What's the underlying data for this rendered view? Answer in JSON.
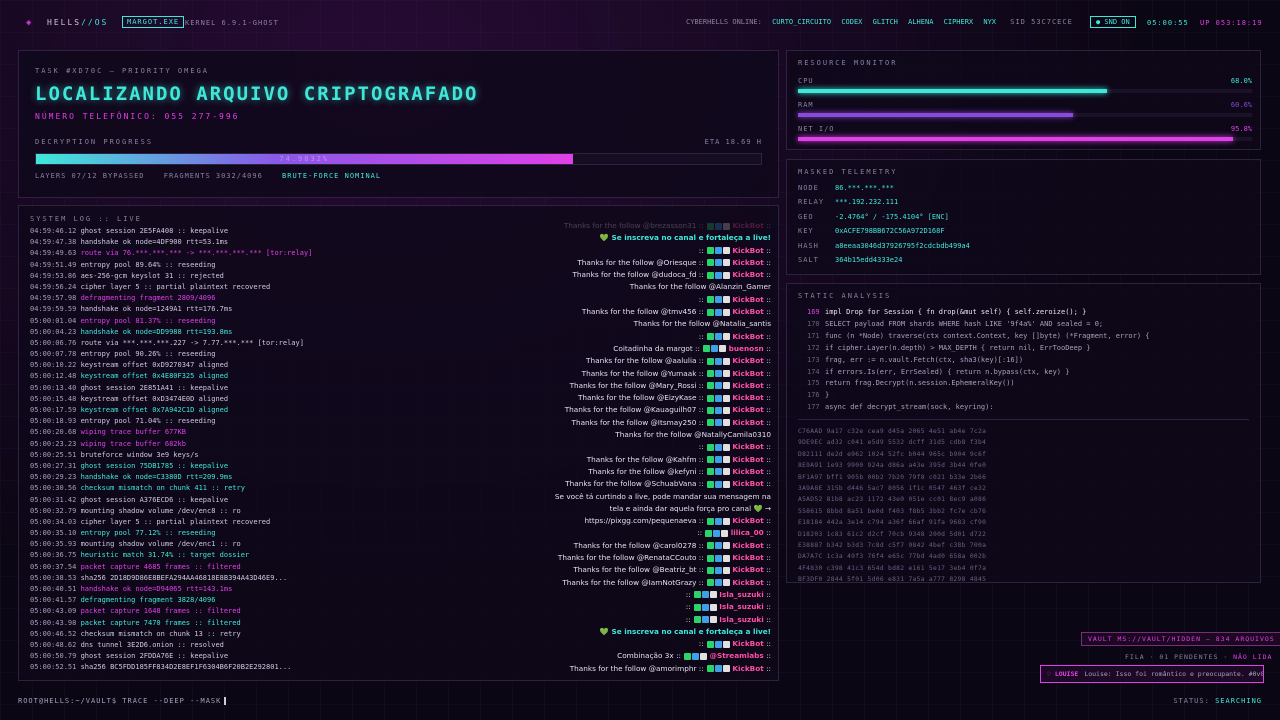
{
  "topbar": {
    "logo": "◈",
    "brand_a": "HELLS",
    "brand_b": "//OS",
    "process": "MARGOT.EXE",
    "kernel": "KERNEL 6.9.1-GHOST",
    "online_label": "CYBERHELLS ONLINE:",
    "online_users": [
      "CURTO_CIRCUITO",
      "CODEX",
      "GLITCH",
      "ALHENA",
      "CIPHERX",
      "NYX"
    ],
    "sid": "SID 53C7CECE",
    "snd": "● SND ON",
    "clock": "05:00:55",
    "uptime": "UP 053:18:19"
  },
  "task": {
    "id": "TASK #XD70C — PRIORITY OMEGA",
    "title": "LOCALIZANDO ARQUIVO CRIPTOGRAFADO",
    "phone": "NÚMERO TELEFÔNICO: 055 277-996",
    "progress_label": "DECRYPTION PROGRESS",
    "eta": "ETA 18.69 H",
    "progress_percent": 74,
    "progress_text": "74.9832%",
    "layers": "LAYERS 07/12 BYPASSED",
    "fragments": "FRAGMENTS 3032/4096",
    "status": "BRUTE-FORCE NOMINAL"
  },
  "syslog": {
    "header": "SYSTEM LOG :: LIVE",
    "lines": [
      {
        "ts": "04:59:46.12",
        "msg": "ghost session 2E5FA408 :: keepalive",
        "tone": ""
      },
      {
        "ts": "04:59:47.38",
        "msg": "handshake ok node=4DF900 rtt=53.1ms",
        "tone": ""
      },
      {
        "ts": "04:59:49.63",
        "msg": "route via 76.***.***.*** -> ***.***.***.*** [tor:relay]",
        "tone": "mag"
      },
      {
        "ts": "04:59:51.49",
        "msg": "entropy pool 89.64% :: reseeding",
        "tone": ""
      },
      {
        "ts": "04:59:53.86",
        "msg": "aes-256-gcm keyslot 31 :: rejected",
        "tone": ""
      },
      {
        "ts": "04:59:56.24",
        "msg": "cipher layer 5 :: partial plaintext recovered",
        "tone": ""
      },
      {
        "ts": "04:59:57.98",
        "msg": "defragmenting fragment 2809/4096",
        "tone": "mag"
      },
      {
        "ts": "04:59:59.59",
        "msg": "handshake ok node=1249A1 rtt=176.7ms",
        "tone": ""
      },
      {
        "ts": "05:00:01.04",
        "msg": "entropy pool 81.37% :: reseeding",
        "tone": "mag"
      },
      {
        "ts": "05:00:04.23",
        "msg": "handshake ok node=DD9988 rtt=193.8ms",
        "tone": "cyan"
      },
      {
        "ts": "05:00:06.76",
        "msg": "route via ***.***.***.227 -> 7.77.***.*** [tor:relay]",
        "tone": ""
      },
      {
        "ts": "05:00:07.78",
        "msg": "entropy pool 90.26% :: reseeding",
        "tone": ""
      },
      {
        "ts": "05:00:10.22",
        "msg": "keystream offset 0xD9270347 aligned",
        "tone": ""
      },
      {
        "ts": "05:00:12.48",
        "msg": "keystream offset 0x4E80F325 aligned",
        "tone": "cyan"
      },
      {
        "ts": "05:00:13.40",
        "msg": "ghost session 2E851A41 :: keepalive",
        "tone": ""
      },
      {
        "ts": "05:00:15.48",
        "msg": "keystream offset 0xD3474E0D aligned",
        "tone": ""
      },
      {
        "ts": "05:00:17.59",
        "msg": "keystream offset 0x7A942C1D aligned",
        "tone": "cyan"
      },
      {
        "ts": "05:00:18.93",
        "msg": "entropy pool 71.04% :: reseeding",
        "tone": ""
      },
      {
        "ts": "05:00:20.68",
        "msg": "wiping trace buffer 677KB",
        "tone": "mag"
      },
      {
        "ts": "05:00:23.23",
        "msg": "wiping trace buffer 682kb",
        "tone": "mag"
      },
      {
        "ts": "05:00:25.51",
        "msg": "bruteforce window 3e9 keys/s",
        "tone": ""
      },
      {
        "ts": "05:00:27.31",
        "msg": "ghost session 75DB1785 :: keepalive",
        "tone": "cyan"
      },
      {
        "ts": "05:00:29.23",
        "msg": "handshake ok node=C3380D rtt=209.9ms",
        "tone": "cyan"
      },
      {
        "ts": "05:00:30.56",
        "msg": "checksum mismatch on chunk 411 :: retry",
        "tone": "cyan"
      },
      {
        "ts": "05:00:31.42",
        "msg": "ghost session A376ECD6 :: keepalive",
        "tone": ""
      },
      {
        "ts": "05:00:32.79",
        "msg": "mounting shadow volume /dev/enc8 :: ro",
        "tone": ""
      },
      {
        "ts": "05:00:34.03",
        "msg": "cipher layer 5 :: partial plaintext recovered",
        "tone": ""
      },
      {
        "ts": "05:00:35.10",
        "msg": "entropy pool 77.12% :: reseeding",
        "tone": "cyan"
      },
      {
        "ts": "05:00:35.93",
        "msg": "mounting shadow volume /dev/enc1 :: ro",
        "tone": ""
      },
      {
        "ts": "05:00:36.75",
        "msg": "heuristic match 31.74% :: target dossier",
        "tone": "cyan"
      },
      {
        "ts": "05:00:37.54",
        "msg": "packet capture 4685 frames :: filtered",
        "tone": "mag"
      },
      {
        "ts": "05:00:38.53",
        "msg": "sha256 2D18D9D86E8BEFA294AA46818E8B394A43D46E9...",
        "tone": ""
      },
      {
        "ts": "05:00:40.51",
        "msg": "handshake ok node=D94065 rtt=143.1ms",
        "tone": "mag"
      },
      {
        "ts": "05:00:41.57",
        "msg": "defragmenting fragment 3828/4096",
        "tone": "cyan"
      },
      {
        "ts": "05:00:43.09",
        "msg": "packet capture 1648 frames :: filtered",
        "tone": "mag"
      },
      {
        "ts": "05:00:43.98",
        "msg": "packet capture 7470 frames :: filtered",
        "tone": "cyan"
      },
      {
        "ts": "05:00:46.52",
        "msg": "checksum mismatch on chunk 13 :: retry",
        "tone": ""
      },
      {
        "ts": "05:00:48.62",
        "msg": "dns tunnel 3E2D6.onion :: resolved",
        "tone": ""
      },
      {
        "ts": "05:00:50.79",
        "msg": "ghost session 2FDDA76E :: keepalive",
        "tone": ""
      },
      {
        "ts": "05:00:52.51",
        "msg": "sha256 BC5FDD185FF834D2E8EF1F6304B6F20B2E292801...",
        "tone": ""
      }
    ]
  },
  "chat": [
    {
      "text": "Thanks for the follow @brezasson31",
      "bot": "KickBot",
      "fade": true
    },
    {
      "text": "💚 Se inscreva no canal e fortaleça a live!",
      "bot": "",
      "hl": true
    },
    {
      "text": "",
      "bot": "KickBot"
    },
    {
      "text": "Thanks for the follow @Oriesque",
      "bot": "KickBot"
    },
    {
      "text": "Thanks for the follow @dudoca_fd",
      "bot": "KickBot"
    },
    {
      "text": "Thanks for the follow @Alanzin_Gamer",
      "bot": ""
    },
    {
      "text": "",
      "bot": "KickBot"
    },
    {
      "text": "Thanks for the follow @tmv456",
      "bot": "KickBot"
    },
    {
      "text": "Thanks for the follow @Natalia_santis",
      "bot": ""
    },
    {
      "text": "",
      "bot": "KickBot"
    },
    {
      "text": "Coitadinha da margot",
      "bot": "buenosn"
    },
    {
      "text": "Thanks for the follow @aalulia",
      "bot": "KickBot"
    },
    {
      "text": "Thanks for the follow @Yumaak",
      "bot": "KickBot"
    },
    {
      "text": "Thanks for the follow @Mary_Rossi",
      "bot": "KickBot"
    },
    {
      "text": "Thanks for the follow @EizyKase",
      "bot": "KickBot"
    },
    {
      "text": "Thanks for the follow @Kauaguilh07",
      "bot": "KickBot"
    },
    {
      "text": "Thanks for the follow @Itsmay250",
      "bot": "KickBot"
    },
    {
      "text": "Thanks for the follow @NatallyCamila0310",
      "bot": ""
    },
    {
      "text": "",
      "bot": "KickBot"
    },
    {
      "text": "Thanks for the follow @Kahfm",
      "bot": "KickBot"
    },
    {
      "text": "Thanks for the follow @kefyni",
      "bot": "KickBot"
    },
    {
      "text": "Thanks for the follow @SchuabVana",
      "bot": "KickBot"
    },
    {
      "text": "Se você tá curtindo a live, pode mandar sua mensagem na",
      "bot": ""
    },
    {
      "text": "tela e ainda dar aquela força pro canal 💚 →",
      "bot": ""
    },
    {
      "text": "https://pixgg.com/pequenaeva",
      "bot": "KickBot"
    },
    {
      "text": "",
      "bot": "lilica_00"
    },
    {
      "text": "Thanks for the follow @carol0278",
      "bot": "KickBot"
    },
    {
      "text": "Thanks for the follow @RenataCCouto",
      "bot": "KickBot"
    },
    {
      "text": "Thanks for the follow @Beatriz_bt",
      "bot": "KickBot"
    },
    {
      "text": "Thanks for the follow @IamNotGrazy",
      "bot": "KickBot"
    },
    {
      "text": "",
      "bot": "Isla_suzuki"
    },
    {
      "text": "",
      "bot": "Isla_suzuki"
    },
    {
      "text": "",
      "bot": "Isla_suzuki"
    },
    {
      "text": "💚 Se inscreva no canal e fortaleça a live!",
      "bot": "",
      "hl": true
    },
    {
      "text": "",
      "bot": "KickBot"
    },
    {
      "text": "Combinação 3x",
      "bot": "@Streamlabs"
    },
    {
      "text": "Thanks for the follow @amorimphr",
      "bot": "KickBot"
    }
  ],
  "resources": {
    "header": "RESOURCE MONITOR",
    "items": [
      {
        "label": "CPU",
        "value": "68.0%",
        "fraction": 0.68,
        "color": "#3ee8d8"
      },
      {
        "label": "RAM",
        "value": "60.6%",
        "fraction": 0.606,
        "color": "#8a4ad8"
      },
      {
        "label": "NET I/O",
        "value": "95.8%",
        "fraction": 0.958,
        "color": "#e040e8"
      }
    ]
  },
  "telemetry": {
    "header": "MASKED TELEMETRY",
    "rows": [
      {
        "k": "NODE",
        "v": "86.***.***.***"
      },
      {
        "k": "RELAY",
        "v": "***.192.232.111"
      },
      {
        "k": "GEO",
        "v": "-2.4764° / -175.4104° [ENC]"
      },
      {
        "k": "KEY",
        "v": "0xACFE798BB672C56A972D168F"
      },
      {
        "k": "HASH",
        "v": "a8eeaa3046d37926795f2cdcbdb499a4"
      },
      {
        "k": "SALT",
        "v": "364b15edd4333e24"
      }
    ]
  },
  "static": {
    "header": "STATIC ANALYSIS",
    "code": [
      {
        "ln": "169",
        "t": "impl Drop for Session { fn drop(&mut self) { self.zeroize(); }",
        "active": true
      },
      {
        "ln": "170",
        "t": "SELECT payload FROM shards WHERE hash LIKE '9f4a%' AND sealed = 0;"
      },
      {
        "ln": "171",
        "t": "func (n *Node) traverse(ctx context.Context, key []byte) (*Fragment, error) {"
      },
      {
        "ln": "172",
        "t": "if cipher.Layer(n.depth) > MAX_DEPTH { return nil, ErrTooDeep }"
      },
      {
        "ln": "173",
        "t": "frag, err := n.vault.Fetch(ctx, sha3(key)[:16])"
      },
      {
        "ln": "174",
        "t": "if errors.Is(err, ErrSealed) { return n.bypass(ctx, key) }"
      },
      {
        "ln": "175",
        "t": "return frag.Decrypt(n.session.EphemeralKey())"
      },
      {
        "ln": "176",
        "t": "}"
      },
      {
        "ln": "177",
        "t": "async def decrypt_stream(sock, keyring):"
      }
    ],
    "hex": [
      "C76AAD 9a17 c32e cea9 d45a 2065 4e51 ab4e 7c2a",
      "9DE9EC ad32 c041 e5d9 5532 dcff 31d5 cdb8 f3b4",
      "D82111 de2d e962 1024 52fc b044 965c b904 9c6f",
      "8E9A91 1e93 9900 924a d86a a43e 395d 3b44 0fe0",
      "BF1A97 bff1 905b 00b2 7b20 79f8 c021 b33e 2b66",
      "3A9A8E 315b d446 5ac7 8056 1f1c 0547 463f ce32",
      "A5AD52 81b8 ac23 1172 43e0 051e cc01 8ec9 a086",
      "558615 8bbd 8a51 be0d f403 f8b5 3bb2 fc7e cb76",
      "E18184 442a 3e14 c794 a36f 66af 91fa 9683 cf90",
      "D18203 1c83 61c2 d2cf 70cb 9348 200d 5d01 d722",
      "E38887 b342 b3d3 7c8d c5f7 9842 4bef c38b 700a",
      "DA7A7C 1c3a 49f3 76f4 e65c 77bd 4ad0 658a 002b",
      "4F4830 c398 41c3 654d bd82 e161 5e17 3eb4 0f7a",
      "BF3DF0 2844 5f01 5d06 e831 7a5a a777 8298 4845"
    ]
  },
  "vault": "VAULT MS://VAULT/HIDDEN — 834 ARQUIVOS",
  "queue": {
    "label": "FILA · 01 PENDENTES ·",
    "state": "NÃO LIDA"
  },
  "notif": {
    "user": "♡ LOUISE",
    "msg": "Louise: Isso foi romântico e preocupante. #0v0"
  },
  "prompt": "ROOT@HELLS:~/VAULT$ TRACE --DEEP --MASK",
  "status": {
    "label": "STATUS:",
    "value": "SEARCHING"
  }
}
